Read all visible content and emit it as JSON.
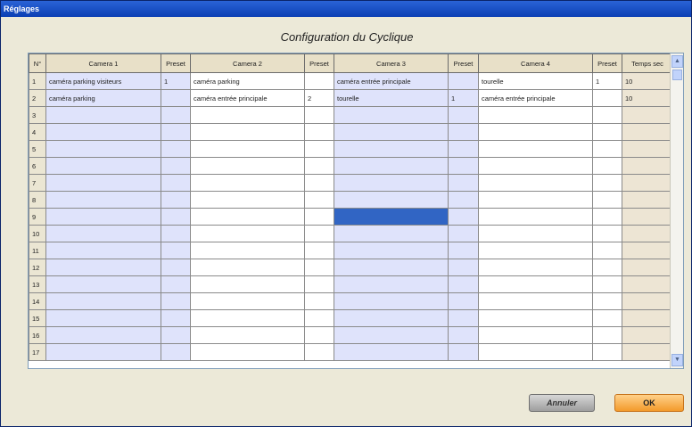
{
  "window": {
    "title": "Réglages"
  },
  "dialog": {
    "title": "Configuration du Cyclique"
  },
  "table": {
    "headers": [
      "N°",
      "Camera 1",
      "Preset",
      "Camera 2",
      "Preset",
      "Camera 3",
      "Preset",
      "Camera 4",
      "Preset",
      "Temps sec"
    ],
    "rows": [
      [
        "1",
        "caméra parking visiteurs",
        "1",
        "caméra parking",
        "",
        "caméra entrée principale",
        "",
        "tourelle",
        "1",
        "10"
      ],
      [
        "2",
        "caméra parking",
        "",
        "caméra entrée principale",
        "2",
        "tourelle",
        "1",
        "caméra entrée principale",
        "",
        "10"
      ],
      [
        "3",
        "",
        "",
        "",
        "",
        "",
        "",
        "",
        "",
        ""
      ],
      [
        "4",
        "",
        "",
        "",
        "",
        "",
        "",
        "",
        "",
        ""
      ],
      [
        "5",
        "",
        "",
        "",
        "",
        "",
        "",
        "",
        "",
        ""
      ],
      [
        "6",
        "",
        "",
        "",
        "",
        "",
        "",
        "",
        "",
        ""
      ],
      [
        "7",
        "",
        "",
        "",
        "",
        "",
        "",
        "",
        "",
        ""
      ],
      [
        "8",
        "",
        "",
        "",
        "",
        "",
        "",
        "",
        "",
        ""
      ],
      [
        "9",
        "",
        "",
        "",
        "",
        "",
        "",
        "",
        "",
        ""
      ],
      [
        "10",
        "",
        "",
        "",
        "",
        "",
        "",
        "",
        "",
        ""
      ],
      [
        "11",
        "",
        "",
        "",
        "",
        "",
        "",
        "",
        "",
        ""
      ],
      [
        "12",
        "",
        "",
        "",
        "",
        "",
        "",
        "",
        "",
        ""
      ],
      [
        "13",
        "",
        "",
        "",
        "",
        "",
        "",
        "",
        "",
        ""
      ],
      [
        "14",
        "",
        "",
        "",
        "",
        "",
        "",
        "",
        "",
        ""
      ],
      [
        "15",
        "",
        "",
        "",
        "",
        "",
        "",
        "",
        "",
        ""
      ],
      [
        "16",
        "",
        "",
        "",
        "",
        "",
        "",
        "",
        "",
        ""
      ],
      [
        "17",
        "",
        "",
        "",
        "",
        "",
        "",
        "",
        "",
        ""
      ]
    ],
    "selected_cell": {
      "row": "9",
      "column": "Camera 3"
    }
  },
  "buttons": {
    "cancel_label": "Annuler",
    "ok_label": "OK"
  },
  "colors": {
    "selection": "#3165c4",
    "blue_columns": "#dfe3fb",
    "ok_button": "#f39a2b",
    "title_bar": "#0b3fb4"
  }
}
